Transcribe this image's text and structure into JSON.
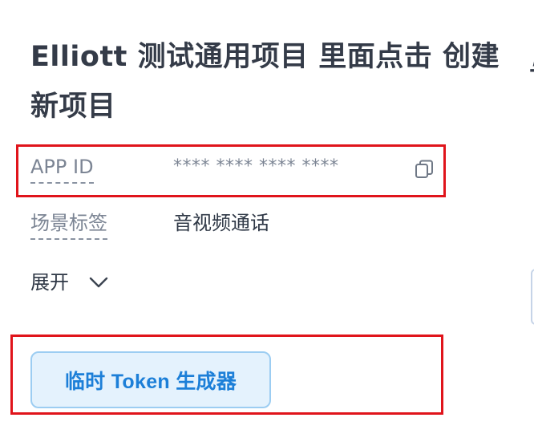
{
  "project": {
    "title": "Elliott 测试通用项目 里面点击 创建新项目"
  },
  "info": {
    "app_id": {
      "label": "APP ID",
      "value": "**** **** **** ****"
    },
    "scene_tag": {
      "label": "场景标签",
      "value": "音视频通话"
    }
  },
  "expand": {
    "label": "展开",
    "icon": "chevron-down-icon"
  },
  "actions": {
    "token_generator_label": "临时 Token 生成器"
  },
  "icons": {
    "copy": "copy-icon"
  },
  "colors": {
    "highlight": "#e0141b",
    "button_bg": "#e4f2fd",
    "button_border": "#9ccdf2",
    "button_text": "#1c7fd8",
    "title": "#343b48",
    "label": "#7c8594"
  }
}
